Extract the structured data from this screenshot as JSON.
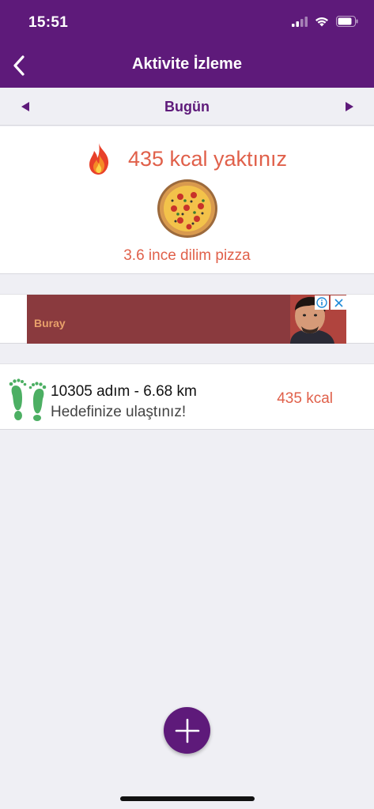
{
  "status_bar": {
    "time": "15:51"
  },
  "nav": {
    "title": "Aktivite İzleme"
  },
  "date_bar": {
    "label": "Bugün"
  },
  "summary": {
    "burned_text": "435 kcal yaktınız",
    "equivalent_text": "3.6 ince dilim pizza"
  },
  "ad": {
    "text": "Buray"
  },
  "activity": {
    "steps_text": "10305 adım - 6.68 km",
    "goal_text": "Hedefinize ulaştınız!",
    "kcal_text": "435 kcal"
  },
  "colors": {
    "brand_purple": "#5e1a7a",
    "accent_orange": "#e0604a",
    "step_green": "#4caf63"
  }
}
